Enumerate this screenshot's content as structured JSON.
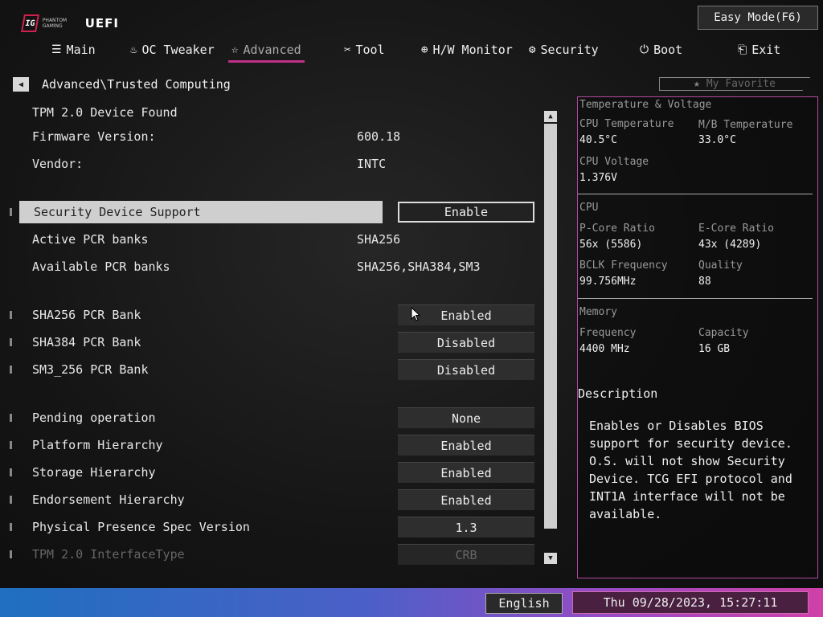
{
  "header": {
    "logo_small": "PHANTOM GAMING",
    "logo_text": "UEFI",
    "easy_mode": "Easy Mode(F6)"
  },
  "nav": {
    "tabs": [
      {
        "label": "Main",
        "icon": "list-icon"
      },
      {
        "label": "OC Tweaker",
        "icon": "flame-icon"
      },
      {
        "label": "Advanced",
        "icon": "star-icon",
        "active": true
      },
      {
        "label": "Tool",
        "icon": "tools-icon"
      },
      {
        "label": "H/W Monitor",
        "icon": "globe-icon"
      },
      {
        "label": "Security",
        "icon": "shield-icon"
      },
      {
        "label": "Boot",
        "icon": "power-icon"
      },
      {
        "label": "Exit",
        "icon": "exit-icon"
      }
    ]
  },
  "breadcrumb": "Advanced\\Trusted Computing",
  "favorite": "My Favorite",
  "info": {
    "device_found": "TPM 2.0 Device Found",
    "firmware_label": "Firmware Version:",
    "firmware_value": "600.18",
    "vendor_label": "Vendor:",
    "vendor_value": "INTC"
  },
  "settings": {
    "security_device_support": {
      "label": "Security Device Support",
      "value": "Enable"
    },
    "active_pcr": {
      "label": "Active PCR banks",
      "value": "SHA256"
    },
    "available_pcr": {
      "label": "Available PCR banks",
      "value": "SHA256,SHA384,SM3"
    },
    "sha256": {
      "label": "SHA256 PCR Bank",
      "value": "Enabled"
    },
    "sha384": {
      "label": "SHA384 PCR Bank",
      "value": "Disabled"
    },
    "sm3": {
      "label": "SM3_256 PCR Bank",
      "value": "Disabled"
    },
    "pending": {
      "label": "Pending operation",
      "value": "None"
    },
    "platform": {
      "label": "Platform Hierarchy",
      "value": "Enabled"
    },
    "storage": {
      "label": "Storage Hierarchy",
      "value": "Enabled"
    },
    "endorsement": {
      "label": "Endorsement Hierarchy",
      "value": "Enabled"
    },
    "physical": {
      "label": "Physical Presence Spec Version",
      "value": "1.3"
    },
    "interface": {
      "label": "TPM 2.0 InterfaceType",
      "value": "CRB"
    }
  },
  "monitor": {
    "title": "Temperature & Voltage",
    "cpu_temp_label": "CPU Temperature",
    "cpu_temp": "40.5°C",
    "mb_temp_label": "M/B Temperature",
    "mb_temp": "33.0°C",
    "cpu_volt_label": "CPU Voltage",
    "cpu_volt": "1.376V",
    "cpu_section": "CPU",
    "pcore_label": "P-Core Ratio",
    "pcore": "56x (5586)",
    "ecore_label": "E-Core Ratio",
    "ecore": "43x (4289)",
    "bclk_label": "BCLK Frequency",
    "bclk": "99.756MHz",
    "quality_label": "Quality",
    "quality": "88",
    "mem_section": "Memory",
    "freq_label": "Frequency",
    "freq": "4400 MHz",
    "cap_label": "Capacity",
    "cap": "16 GB"
  },
  "description": {
    "title": "Description",
    "text": "Enables or Disables BIOS support for security device. O.S. will not show Security Device. TCG EFI protocol and INT1A interface will not be available."
  },
  "footer": {
    "language": "English",
    "datetime": "Thu 09/28/2023, 15:27:11"
  }
}
